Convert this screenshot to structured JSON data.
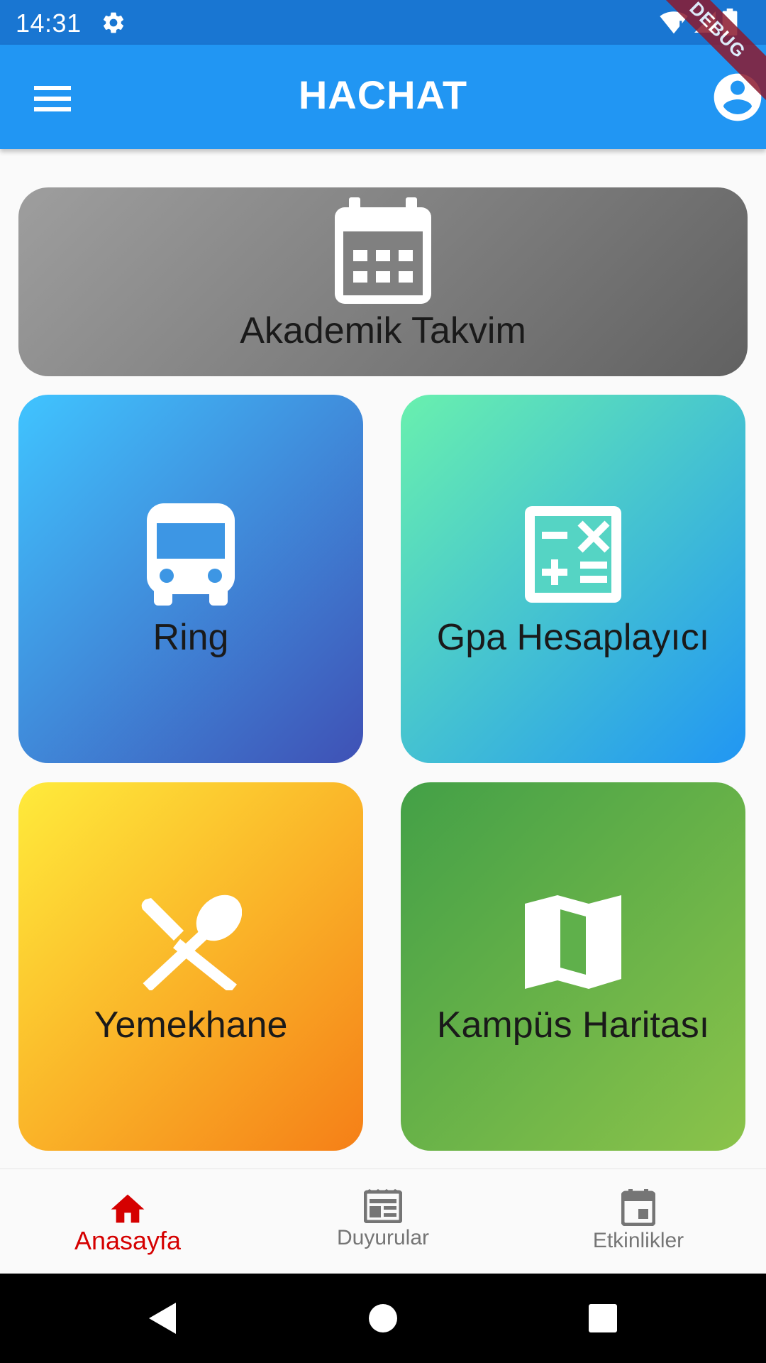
{
  "status_bar": {
    "time": "14:31",
    "icons": [
      "gear-icon",
      "wifi-icon",
      "signal-icon",
      "battery-icon"
    ]
  },
  "app_bar": {
    "title": "HACHAT",
    "menu_icon": "menu-icon",
    "profile_icon": "account-circle-icon"
  },
  "debug_banner": "DEBUG",
  "cards": {
    "calendar": {
      "label": "Akademik Takvim",
      "icon": "calendar-icon"
    },
    "ring": {
      "label": "Ring",
      "icon": "bus-icon"
    },
    "gpa": {
      "label": "Gpa Hesaplayıcı",
      "icon": "calculator-icon"
    },
    "food": {
      "label": "Yemekhane",
      "icon": "restaurant-icon"
    },
    "map": {
      "label": "Kampüs Haritası",
      "icon": "map-icon"
    }
  },
  "bottom_nav": {
    "items": [
      {
        "label": "Anasayfa",
        "icon": "home-icon",
        "active": true
      },
      {
        "label": "Duyurular",
        "icon": "newspaper-icon",
        "active": false
      },
      {
        "label": "Etkinlikler",
        "icon": "event-icon",
        "active": false
      }
    ]
  },
  "colors": {
    "status_bar": "#1976d2",
    "app_bar": "#2196f3",
    "active_nav": "#d50000",
    "inactive_nav": "#757575"
  }
}
